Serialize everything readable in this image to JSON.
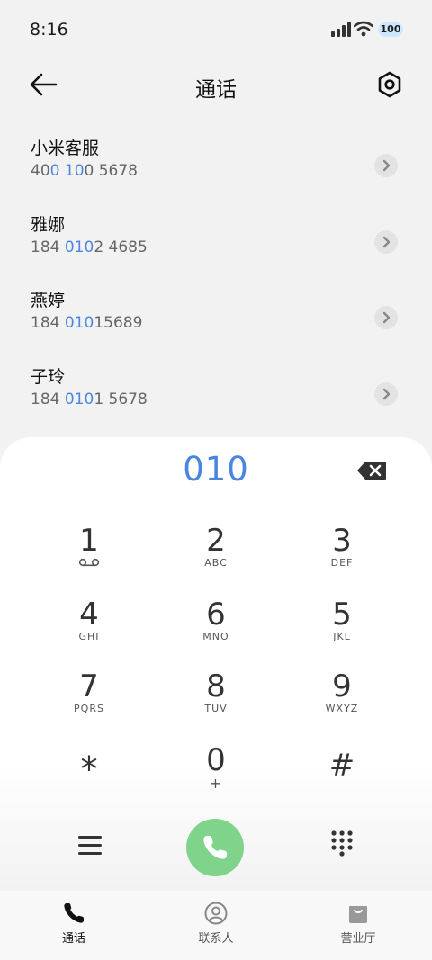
{
  "status": {
    "time": "8:16",
    "battery": "100"
  },
  "header": {
    "title": "通话"
  },
  "contacts": [
    {
      "name": "小米客服",
      "pre": "40",
      "hl1": "0",
      "mid": " ",
      "hl2": "10",
      "post": "0 5678"
    },
    {
      "name": "雅娜",
      "pre": "184 ",
      "hl1": "010",
      "mid": "",
      "hl2": "",
      "post": "2 4685"
    },
    {
      "name": "燕婷",
      "pre": "184 ",
      "hl1": "010",
      "mid": "",
      "hl2": "",
      "post": "15689"
    },
    {
      "name": "子玲",
      "pre": "184 ",
      "hl1": "010",
      "mid": "",
      "hl2": "",
      "post": "1 5678"
    }
  ],
  "dialpad": {
    "input": "010",
    "keys": [
      {
        "digit": "1",
        "letters": ""
      },
      {
        "digit": "2",
        "letters": "ABC"
      },
      {
        "digit": "3",
        "letters": "DEF"
      },
      {
        "digit": "4",
        "letters": "GHI"
      },
      {
        "digit": "5",
        "letters": "JKL"
      },
      {
        "digit": "6",
        "letters": "MNO"
      },
      {
        "digit": "7",
        "letters": "PQRS"
      },
      {
        "digit": "8",
        "letters": "TUV"
      },
      {
        "digit": "9",
        "letters": "WXYZ"
      },
      {
        "digit": "*",
        "letters": ""
      },
      {
        "digit": "0",
        "letters": "+"
      },
      {
        "digit": "#",
        "letters": ""
      }
    ]
  },
  "nav": {
    "calls": "通话",
    "contacts": "联系人",
    "store": "营业厅"
  },
  "colors": {
    "accent": "#4a86e0",
    "call": "#7fd38b",
    "background": "#f2f2f2"
  },
  "icons": {
    "back": "arrow-left-icon",
    "settings": "settings-hexagon-icon",
    "voicemail": "voicemail-icon",
    "backspace": "backspace-icon",
    "menu": "menu-icon",
    "call": "phone-icon",
    "keypad": "keypad-icon"
  }
}
